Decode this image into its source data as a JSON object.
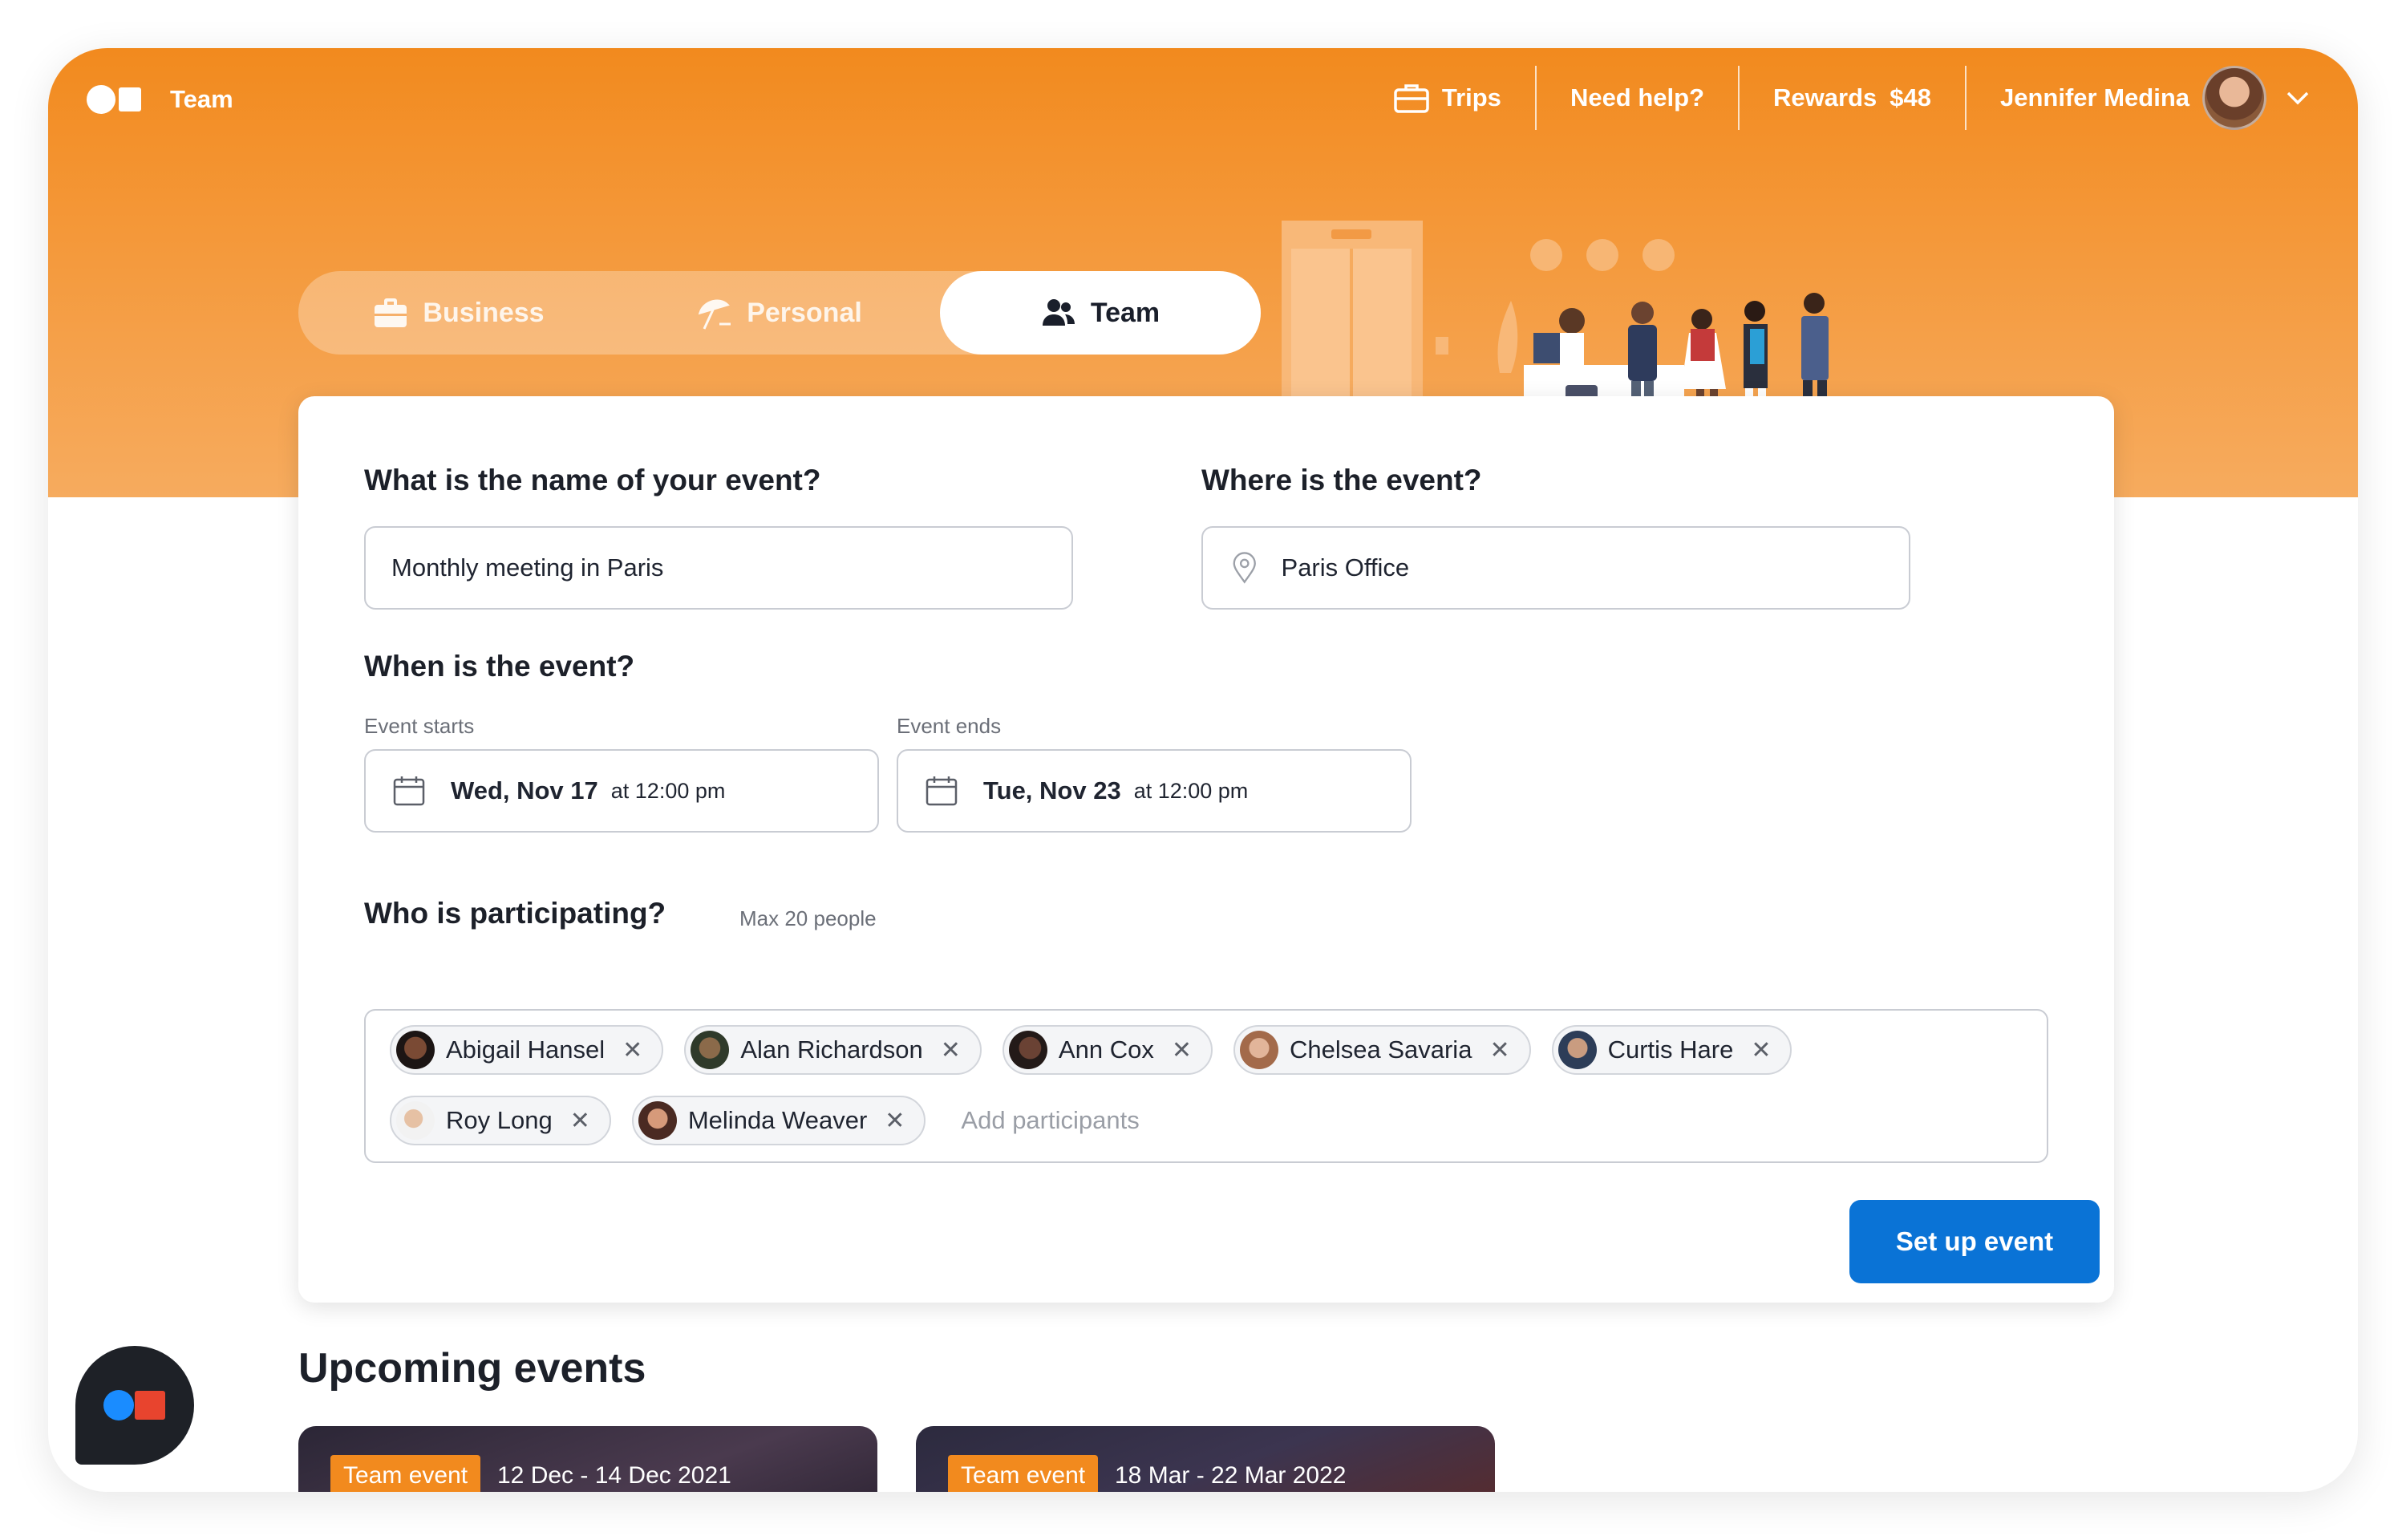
{
  "header": {
    "app_name": "Team",
    "nav": {
      "trips_label": "Trips",
      "help_label": "Need help?",
      "rewards_label": "Rewards",
      "rewards_amount": "$48",
      "user_name": "Jennifer Medina"
    }
  },
  "tabs": [
    {
      "label": "Business",
      "icon": "briefcase-icon",
      "active": false
    },
    {
      "label": "Personal",
      "icon": "beach-umbrella-icon",
      "active": false
    },
    {
      "label": "Team",
      "icon": "people-icon",
      "active": true
    }
  ],
  "form": {
    "event_name_question": "What is the name of your event?",
    "event_name_value": "Monthly meeting in Paris",
    "location_question": "Where is the event?",
    "location_value": "Paris Office",
    "when_question": "When is the event?",
    "start_label": "Event starts",
    "start_date": "Wed, Nov 17",
    "start_time": "at 12:00 pm",
    "end_label": "Event ends",
    "end_date": "Tue, Nov 23",
    "end_time": "at 12:00 pm",
    "participants_question": "Who is participating?",
    "participants_hint": "Max 20 people",
    "participants": [
      "Abigail Hansel",
      "Alan Richardson",
      "Ann Cox",
      "Chelsea Savaria",
      "Curtis Hare",
      "Roy Long",
      "Melinda Weaver"
    ],
    "add_participants_placeholder": "Add participants",
    "submit_label": "Set up event"
  },
  "upcoming": {
    "title": "Upcoming events",
    "events": [
      {
        "badge": "Team event",
        "dates": "12 Dec - 14 Dec 2021"
      },
      {
        "badge": "Team event",
        "dates": "18 Mar - 22 Mar 2022"
      }
    ]
  },
  "colors": {
    "brand_orange": "#f28a1e",
    "primary_blue": "#0a73d6",
    "chat_red": "#e8442e",
    "chat_blue": "#1a8cff"
  }
}
